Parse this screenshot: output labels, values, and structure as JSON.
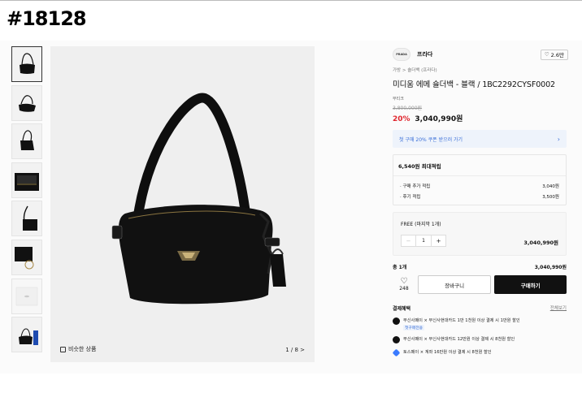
{
  "listing_no": "#18128",
  "thumbnails": [
    "thumb-front",
    "thumb-angle",
    "thumb-side",
    "thumb-interior",
    "thumb-strap-side",
    "thumb-charm",
    "thumb-dustbag",
    "thumb-packaging"
  ],
  "gallery": {
    "similar_label": "비슷한 상품",
    "counter": "1 / 8 >"
  },
  "product": {
    "brand_logo_text": "PRADA",
    "brand": "프라다",
    "likes": "2.6만",
    "breadcrumb": "가방 > 숄더백 (프라다)",
    "title": "미디움 에메 숄더백 - 블랙 / 1BC2292CYSF0002",
    "store_tag": "부티크",
    "original_price": "3,800,000원",
    "discount": "20%",
    "price": "3,040,990원"
  },
  "coupon": {
    "text": "첫 구매 20% 쿠폰 받으러 가기",
    "chevron": "›"
  },
  "points": {
    "header": "6,540원 최대적립",
    "rows": [
      {
        "label": "· 구매 추가 적립",
        "value": "3,040원"
      },
      {
        "label": "· 후기 적립",
        "value": "3,500원"
      }
    ]
  },
  "option": {
    "label": "FREE (마지막 1개)",
    "minus": "−",
    "qty": "1",
    "plus": "+",
    "price": "3,040,990원"
  },
  "total": {
    "label": "총 1개",
    "value": "3,040,990원"
  },
  "actions": {
    "heart_count": "248",
    "cart": "장바구니",
    "buy": "구매하기"
  },
  "benefits": {
    "title": "결제혜택",
    "view_all": "전체보기",
    "items": [
      {
        "text": "무신사페이 × 무신사현대카드 1만 1천원 이상 결제 시 1만원 할인",
        "sub": "첫구매전용"
      },
      {
        "text": "무신사페이 × 무신사현대카드 12만원 이상 결제 시 8천원 할인"
      },
      {
        "text": "토스페이 × 계좌 16만원 이상 결제 시 8천원 할인"
      }
    ]
  },
  "colors": {
    "accent_red": "#e0262e",
    "buy_button": "#111111",
    "coupon_blue": "#3a6fd8"
  }
}
